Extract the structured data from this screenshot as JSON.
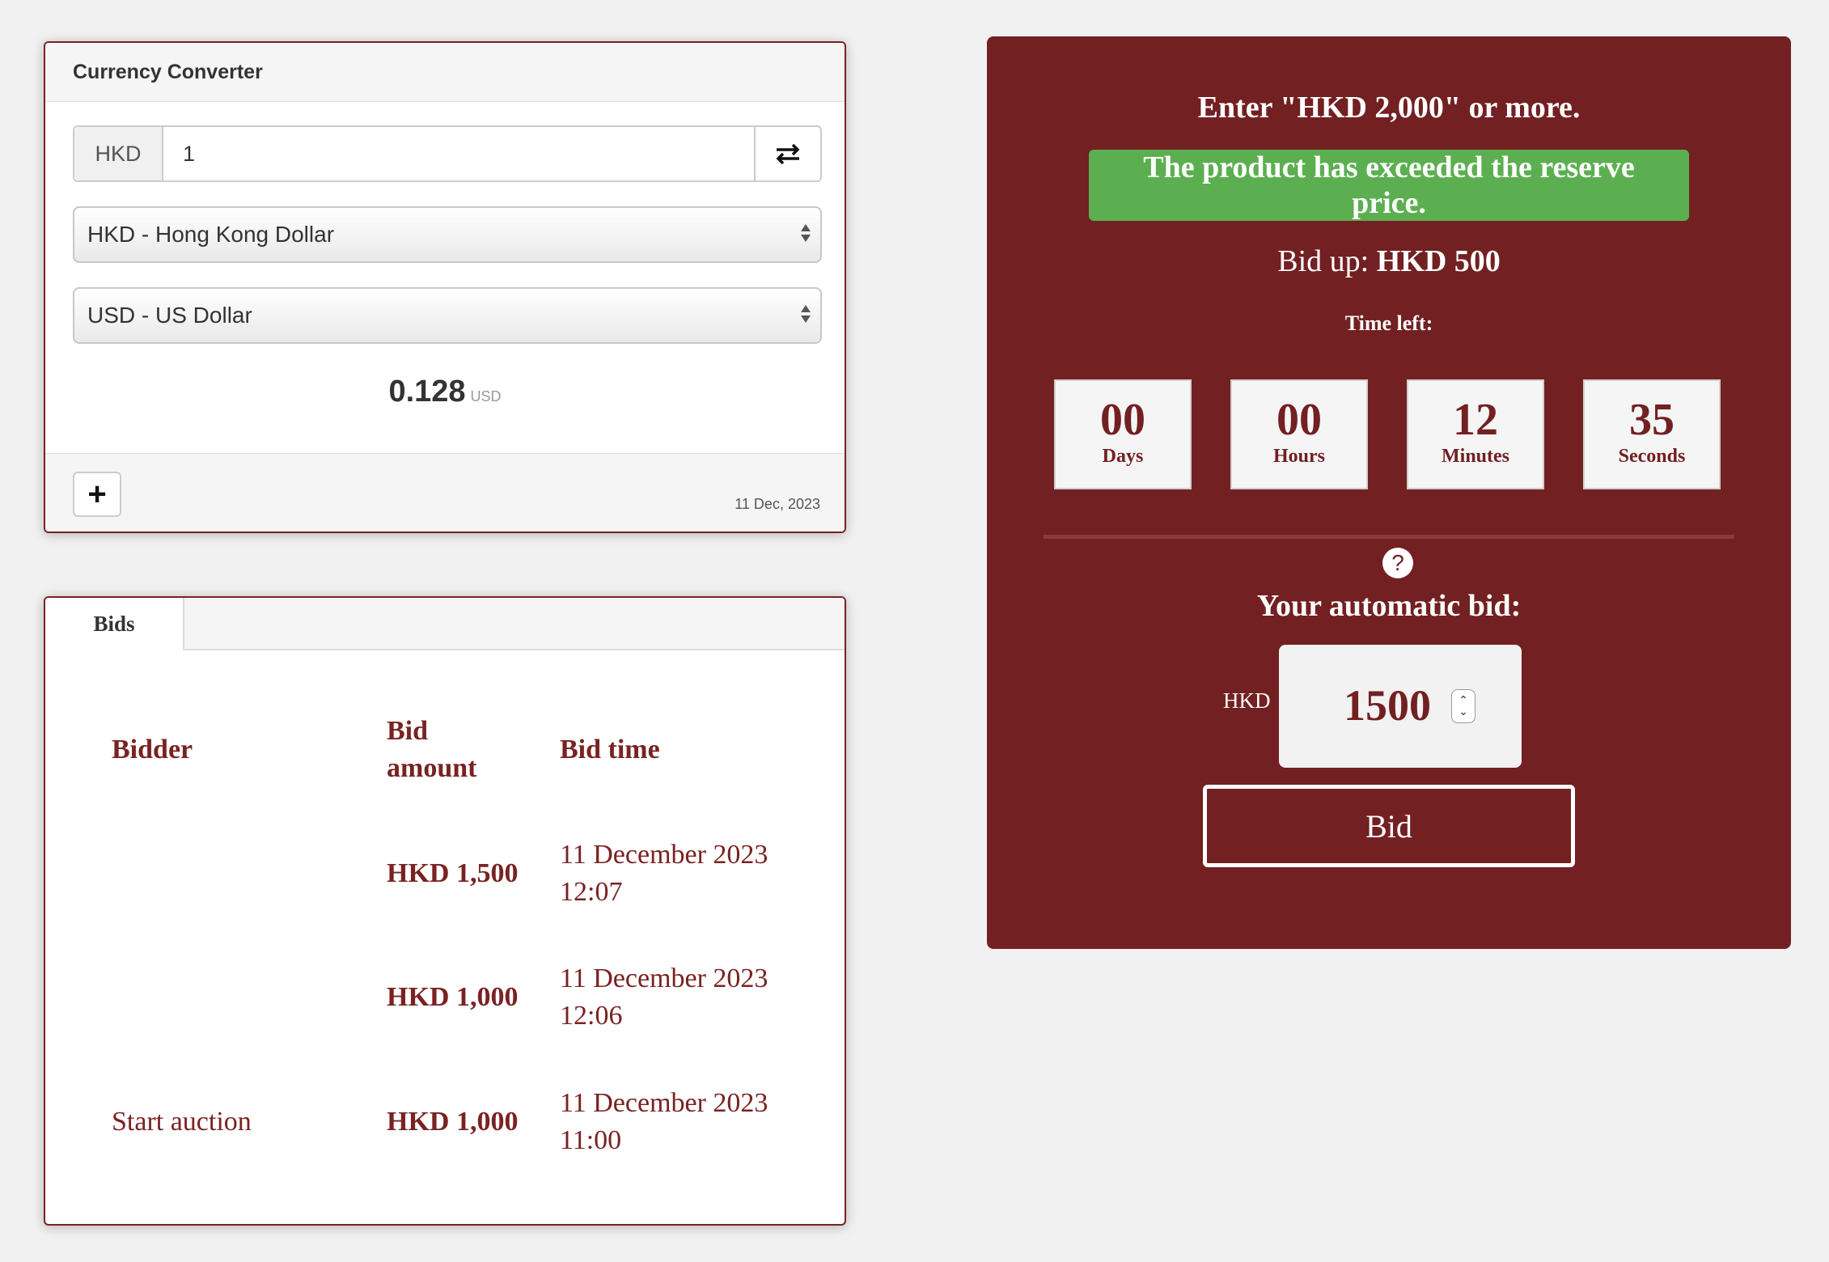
{
  "currency_converter": {
    "title": "Currency Converter",
    "amount_currency": "HKD",
    "amount_value": "1",
    "from_currency": "HKD - Hong Kong Dollar",
    "to_currency": "USD - US Dollar",
    "result_value": "0.128",
    "result_unit": "USD",
    "add_label": "+",
    "date": "11 Dec, 2023"
  },
  "bids": {
    "tab": "Bids",
    "headers": {
      "bidder": "Bidder",
      "amount_line1": "Bid",
      "amount_line2": "amount",
      "time": "Bid time"
    },
    "rows": [
      {
        "bidder": "",
        "amount": "HKD 1,500",
        "date": "11 December 2023",
        "time": "12:07"
      },
      {
        "bidder": "",
        "amount": "HKD 1,000",
        "date": "11 December 2023",
        "time": "12:06"
      },
      {
        "bidder": "Start auction",
        "amount": "HKD 1,000",
        "date": "11 December 2023",
        "time": "11:00"
      }
    ]
  },
  "auction": {
    "enter_text": "Enter \"HKD 2,000\" or more.",
    "reserve_line1": "The product has exceeded the reserve",
    "reserve_line2": "price.",
    "bid_up_label": "Bid up:",
    "bid_up_value": "HKD 500",
    "time_left": "Time left:",
    "countdown": [
      {
        "value": "00",
        "label": "Days"
      },
      {
        "value": "00",
        "label": "Hours"
      },
      {
        "value": "12",
        "label": "Minutes"
      },
      {
        "value": "35",
        "label": "Seconds"
      }
    ],
    "help_icon": "?",
    "auto_bid_label": "Your automatic bid:",
    "currency_label": "HKD",
    "auto_bid_value": "1500",
    "bid_button": "Bid"
  },
  "colors": {
    "accent": "#722022",
    "success": "#5caf50",
    "background": "#f1f1f1"
  }
}
